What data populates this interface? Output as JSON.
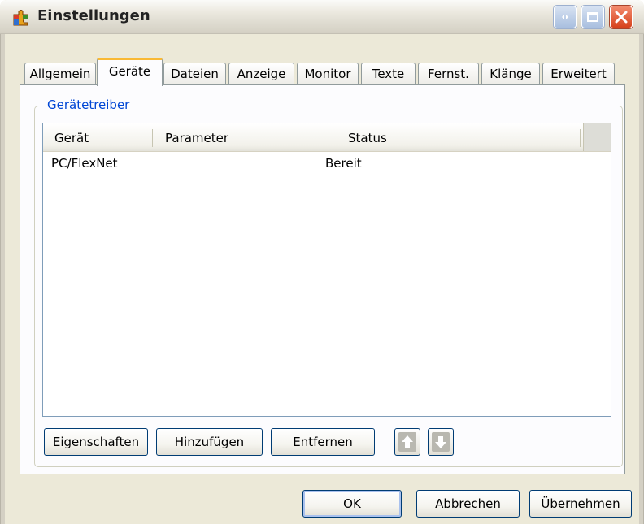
{
  "window": {
    "title": "Einstellungen",
    "app_icon": "puzzle-icon"
  },
  "titlebar_buttons": {
    "restore_icon": "restore-icon",
    "maximize_icon": "maximize-icon",
    "close_icon": "close-icon",
    "close_color": "#d6421c"
  },
  "tabs": [
    {
      "label": "Allgemein"
    },
    {
      "label": "Geräte"
    },
    {
      "label": "Dateien"
    },
    {
      "label": "Anzeige"
    },
    {
      "label": "Monitor"
    },
    {
      "label": "Texte"
    },
    {
      "label": "Fernst."
    },
    {
      "label": "Klänge"
    },
    {
      "label": "Erweitert"
    }
  ],
  "active_tab": "Geräte",
  "group": {
    "label": "Gerätetreiber",
    "label_color": "#0046d5"
  },
  "device_list": {
    "columns": [
      "Gerät",
      "Parameter",
      "Status"
    ],
    "rows": [
      {
        "geraet": "PC/FlexNet",
        "parameter": "",
        "status": "Bereit"
      }
    ]
  },
  "actions": {
    "properties": "Eigenschaften",
    "add": "Hinzufügen",
    "remove": "Entfernen",
    "move_up_icon": "arrow-up-icon",
    "move_down_icon": "arrow-down-icon"
  },
  "dialog_buttons": {
    "ok": "OK",
    "cancel": "Abbrechen",
    "apply": "Übernehmen"
  }
}
